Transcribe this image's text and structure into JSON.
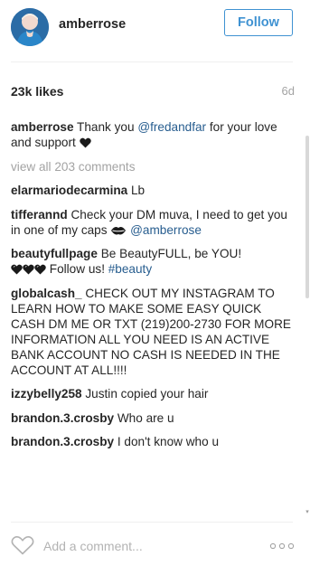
{
  "post": {
    "username": "amberrose",
    "follow_label": "Follow",
    "likes": "23k likes",
    "age": "6d"
  },
  "comments": {
    "caption": {
      "author": "amberrose",
      "text_before": "Thank you ",
      "mention": "@fredandfar",
      "text_after": " for your love and support "
    },
    "view_all": "view all 203 comments",
    "items": [
      {
        "author": "elarmariodecarmina",
        "text": "Lb"
      },
      {
        "author": "tifferannd",
        "text": "Check your DM muva, I need to get you in one of my caps ",
        "mention": "@amberrose"
      },
      {
        "author": "beautyfullpage",
        "text": "Be BeautyFULL, be YOU! ",
        "text2": " Follow us! ",
        "hashtag": "#beauty"
      },
      {
        "author": "globalcash_",
        "text": "CHECK OUT MY INSTAGRAM TO LEARN HOW TO MAKE SOME EASY QUICK CASH DM ME OR TXT (219)200-2730 FOR MORE INFORMATION ALL YOU NEED IS AN ACTIVE BANK ACCOUNT NO CASH IS NEEDED IN THE ACCOUNT AT ALL!!!!"
      },
      {
        "author": "izzybelly258",
        "text": "Justin copied your hair"
      },
      {
        "author": "brandon.3.crosby",
        "text": "Who are u"
      },
      {
        "author": "brandon.3.crosby",
        "text": "I don't know who u"
      }
    ]
  },
  "footer": {
    "add_comment_placeholder": "Add a comment...",
    "icons": [
      "heart-outline-icon",
      "more-options-icon"
    ]
  },
  "colors": {
    "accent_blue": "#3f92d2",
    "link_blue": "#275d8f",
    "muted_gray": "#a3a3a3",
    "text_dark": "#262626"
  }
}
